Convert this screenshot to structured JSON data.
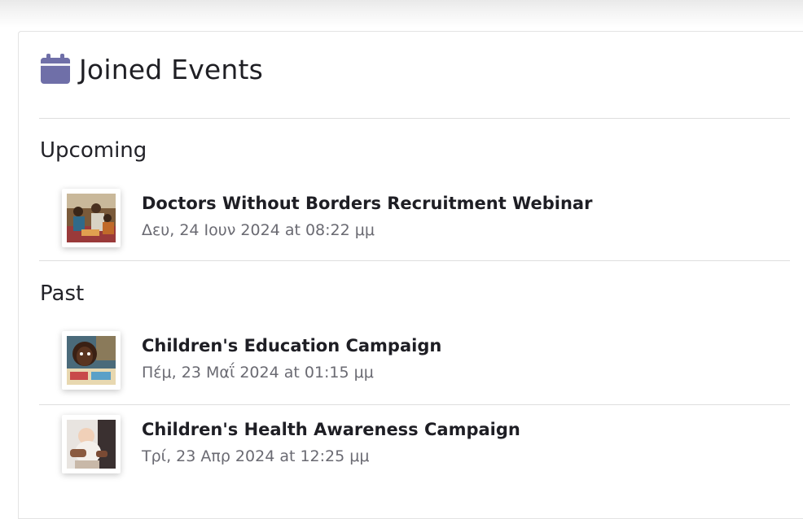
{
  "card": {
    "title": "Joined Events",
    "icon": "calendar-icon",
    "accent_color": "#6f6fa8"
  },
  "sections": {
    "upcoming": {
      "heading": "Upcoming",
      "events": [
        {
          "title": "Doctors Without Borders Recruitment Webinar",
          "date": "Δευ, 24 Ιουν 2024 at 08:22 μμ"
        }
      ]
    },
    "past": {
      "heading": "Past",
      "events": [
        {
          "title": "Children's Education Campaign",
          "date": "Πέμ, 23 Μαΐ 2024 at 01:15 μμ"
        },
        {
          "title": "Children's Health Awareness Campaign",
          "date": "Τρί, 23 Απρ 2024 at 12:25 μμ"
        }
      ]
    }
  }
}
